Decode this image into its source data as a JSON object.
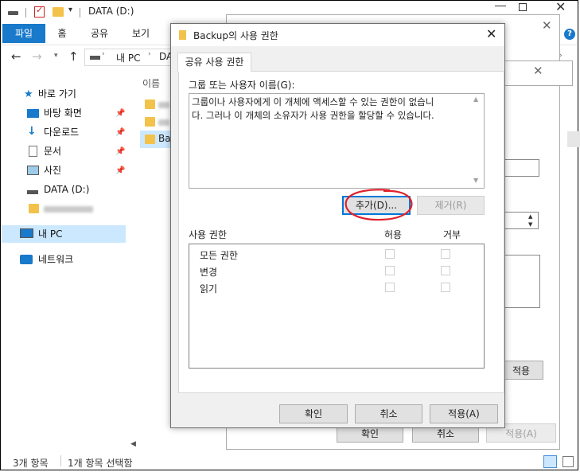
{
  "explorer": {
    "window_title": "DATA (D:)",
    "ribbon_tabs": [
      "파일",
      "홈",
      "공유",
      "보기"
    ],
    "address_path": [
      "내 PC",
      "DA"
    ],
    "column_header": "이름",
    "nav": {
      "quick_access": "바로 가기",
      "desktop": "바탕 화면",
      "downloads": "다운로드",
      "documents": "문서",
      "pictures": "사진",
      "data_drive": "DATA (D:)",
      "this_pc": "내 PC",
      "network": "네트워크"
    },
    "file_partial": "Ba",
    "status_count": "3개 항목",
    "status_selected": "1개 항목 선택함"
  },
  "background_dialog": {
    "apply_partial": "적용",
    "ok": "확인",
    "cancel": "취소",
    "apply": "적용(A)"
  },
  "dialog": {
    "title": "Backup의 사용 권한",
    "tab_label": "공유 사용 권한",
    "group_label": "그룹 또는 사용자 이름(G):",
    "group_info_line1": "그룹이나 사용자에게 이 개체에 액세스할 수 있는 권한이 없습니",
    "group_info_line2": "다. 그러나 이 개체의 소유자가 사용 권한을 할당할 수 있습니다.",
    "add_button": "추가(D)...",
    "remove_button": "제거(R)",
    "perm_header": "사용 권한",
    "allow_header": "허용",
    "deny_header": "거부",
    "permissions": [
      {
        "name": "모든 권한",
        "allow": false,
        "deny": false
      },
      {
        "name": "변경",
        "allow": false,
        "deny": false
      },
      {
        "name": "읽기",
        "allow": false,
        "deny": false
      }
    ],
    "ok_button": "확인",
    "cancel_button": "취소",
    "apply_button": "적용(A)"
  },
  "colors": {
    "accent": "#1979ca",
    "folder": "#f3c24b",
    "annotation_red": "#e0202a",
    "focus_border": "#0078d7"
  }
}
